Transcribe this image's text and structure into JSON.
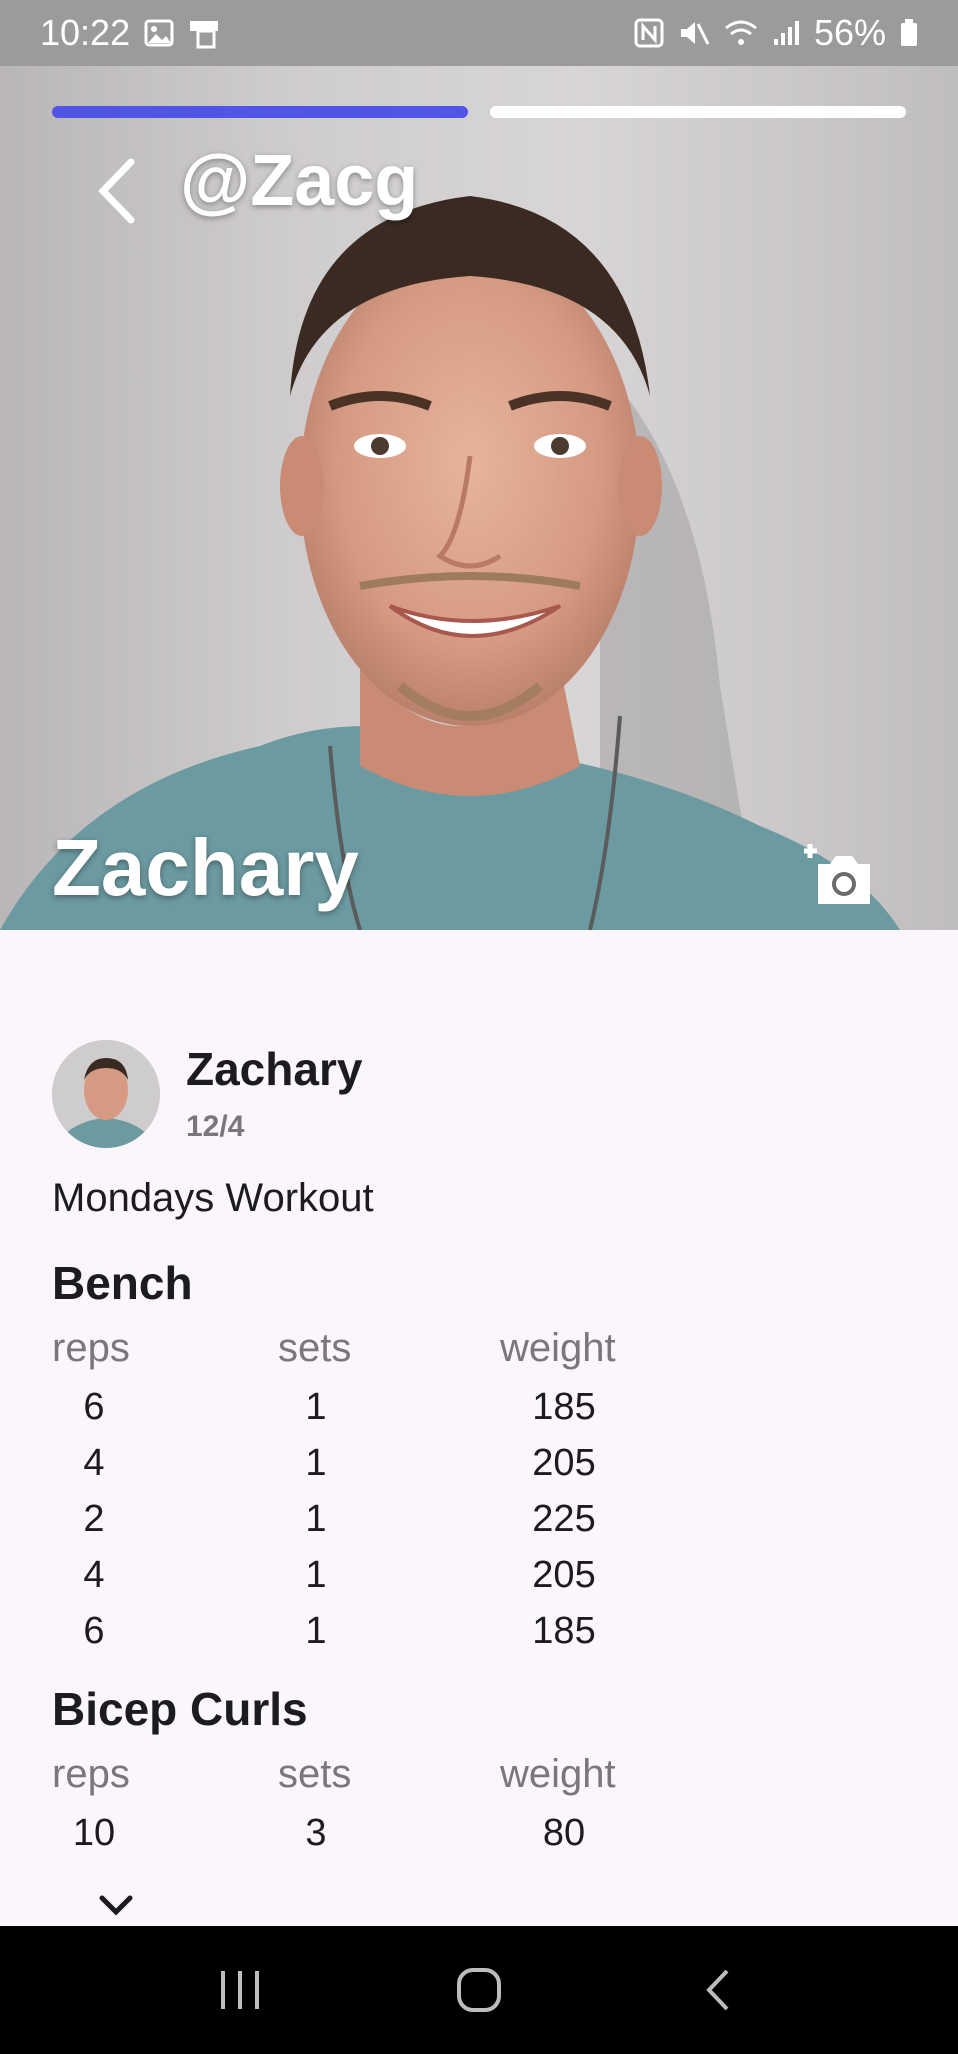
{
  "status_bar": {
    "time": "10:22",
    "battery": "56%",
    "icons": [
      "gallery-icon",
      "tablet-icon",
      "nfc-icon",
      "mute-icon",
      "wifi-icon",
      "signal-icon",
      "battery-icon"
    ]
  },
  "story": {
    "handle": "@Zacg",
    "name": "Zachary",
    "progress": [
      1,
      0
    ],
    "accent_color": "#4f55e8"
  },
  "post": {
    "author": "Zachary",
    "date": "12/4",
    "title": "Mondays Workout",
    "exercises": [
      {
        "name": "Bench",
        "headers": [
          "reps",
          "sets",
          "weight"
        ],
        "rows": [
          [
            "6",
            "1",
            "185"
          ],
          [
            "4",
            "1",
            "205"
          ],
          [
            "2",
            "1",
            "225"
          ],
          [
            "4",
            "1",
            "205"
          ],
          [
            "6",
            "1",
            "185"
          ]
        ]
      },
      {
        "name": "Bicep Curls",
        "headers": [
          "reps",
          "sets",
          "weight"
        ],
        "rows": [
          [
            "10",
            "3",
            "80"
          ]
        ]
      }
    ]
  }
}
